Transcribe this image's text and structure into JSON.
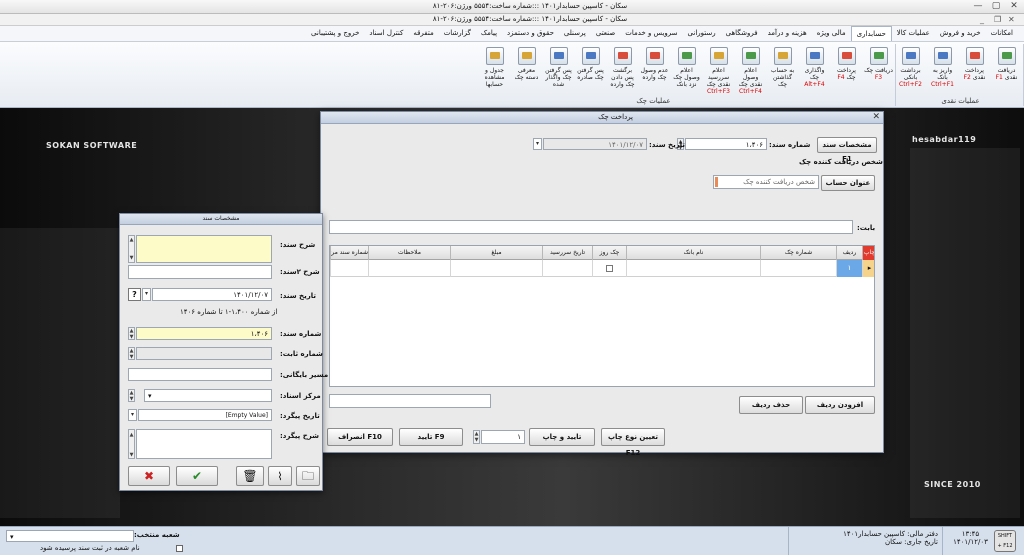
{
  "window": {
    "title": "سکان - کاسپین حسابدار۱۴۰۱ :::شماره ساخت:۵۵۵۴ ورژن:۲۰۶-۸۱",
    "subtitle": "سکان - کاسپین حسابدار۱۴۰۱ :::شماره ساخت:۵۵۵۴ ورژن:۲۰۶-۸۱"
  },
  "menu": [
    "امکانات",
    "خرید و فروش",
    "عملیات کالا",
    "حسابداری",
    "مالی ویژه",
    "هزینه و درآمد",
    "فروشگاهی",
    "رستورانی",
    "سرویس و خدمات",
    "صنعتی",
    "پرسنلی",
    "حقوق و دستمزد",
    "پیامک",
    "گزارشات",
    "متفرقه",
    "کنترل اسناد",
    "خروج و پشتیبانی"
  ],
  "menu_active_index": 3,
  "ribbon": {
    "group_naqdi": {
      "label": "عملیات نقدی",
      "buttons": [
        {
          "text": "دریافت نقدی",
          "key": "F1",
          "color": "green"
        },
        {
          "text": "پرداخت نقدی",
          "key": "F2",
          "color": "red"
        },
        {
          "text": "واریز به بانک",
          "key": "Ctrl+F1",
          "color": "blue"
        },
        {
          "text": "برداشت بانکی",
          "key": "Ctrl+F2",
          "color": "blue"
        }
      ]
    },
    "group_chek": {
      "label": "عملیات چک",
      "buttons": [
        {
          "text": "دریافت چک",
          "key": "F3",
          "color": "green"
        },
        {
          "text": "پرداخت چک",
          "key": "F4",
          "color": "red"
        },
        {
          "text": "واگذاری چک",
          "key": "Alt+F4",
          "color": "blue"
        },
        {
          "text": "به حساب گذاشتن چک",
          "key": "",
          "color": "gold"
        },
        {
          "text": "اعلام وصول نقدی چک",
          "key": "Ctrl+F4",
          "color": "green"
        },
        {
          "text": "اعلام سررسید نقدی چک",
          "key": "Ctrl+F3",
          "color": "gold"
        },
        {
          "text": "اعلام وصول چک نزد بانک",
          "key": "",
          "color": "green"
        },
        {
          "text": "عدم وصول چک وارده",
          "key": "",
          "color": "red"
        },
        {
          "text": "برگشت پس دادن چک وارده",
          "key": "",
          "color": "red"
        },
        {
          "text": "پس گرفتن چک صادره",
          "key": "",
          "color": "blue"
        },
        {
          "text": "پس گرفتن چک واگذار شده",
          "key": "",
          "color": "blue"
        },
        {
          "text": "معرفی دسته چک",
          "key": "",
          "color": "gold"
        },
        {
          "text": "جدول و مشاهده حسابها",
          "key": "",
          "color": "gold"
        }
      ]
    }
  },
  "desktop": {
    "left_brand": "SOKAN SOFTWARE",
    "right_brand": "hesabdar119",
    "since": "SINCE 2010"
  },
  "dialog": {
    "title": "پرداخت چک",
    "doc_spec_button": "مشخصات سند F1",
    "doc_number_label": "شماره سند:",
    "doc_number": "۱،۴۰۶",
    "doc_date_label": "تاریخ سند:",
    "doc_date": "۱۴۰۱/۱۲/۰۷",
    "receiver_section": "شخص دریافت کننده چک",
    "account_button": "عنوان حساب",
    "receiver_placeholder": "شخص دریافت کننده چک",
    "babat_label": "بابت:",
    "grid": {
      "columns": [
        "چاپ",
        "ردیف",
        "شماره چک",
        "نام بانک",
        "چک روز",
        "تاریخ سررسید",
        "مبلغ",
        "ملاحظات",
        "شماره سند مرتبط"
      ],
      "rows": [
        {
          "radif": "۱"
        }
      ]
    },
    "add_row_button": "افزودن ردیف",
    "delete_row_button": "حذف ردیف",
    "print_type_button": "تعیین نوع چاپ F12",
    "confirm_print_button": "تایید و چاپ",
    "copies": "۱",
    "confirm_button": "تایید F9",
    "cancel_button": "انصراف F10"
  },
  "side": {
    "title": "مشخصات سند",
    "sharh_label": "شرح سند:",
    "sharh2_label": "شرح ۲سند:",
    "date_label": "تاریخ سند:",
    "date_value": "۱۴۰۱/۱۲/۰۷",
    "range_text": "از شماره ۱،۴۰۰-۱ تا شماره ۱۴۰۶",
    "number_label": "شماره سند:",
    "number_value": "۱،۴۰۶",
    "fixed_label": "شماره ثابت:",
    "archive_label": "مسیر بایگانی:",
    "center_label": "مرکز اسناد:",
    "followup_date_label": "تاریخ پیگرد:",
    "followup_date_value": "[Empty Value]",
    "followup_desc_label": "شرح پیگرد:"
  },
  "status": {
    "branch_label": "شعبه منتخب:",
    "branch_checkbox": "نام شعبه در ثبت سند پرسیده شود",
    "ledger": "دفتر مالی: کاسپین حسابدار۱۴۰۱",
    "current_date": "تاریخ جاری: سکان",
    "time": "۱۳:۴۵",
    "date": "۱۴۰۱/۱۲/۰۳",
    "kbd_label": "SHIFT + F12"
  }
}
